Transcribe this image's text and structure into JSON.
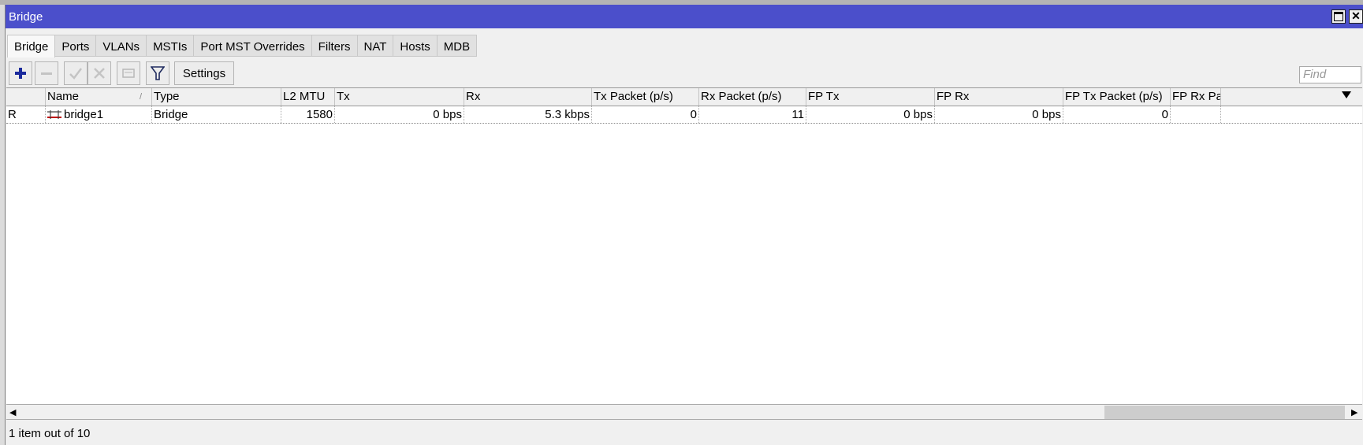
{
  "window": {
    "title": "Bridge"
  },
  "tabs": [
    {
      "label": "Bridge"
    },
    {
      "label": "Ports"
    },
    {
      "label": "VLANs"
    },
    {
      "label": "MSTIs"
    },
    {
      "label": "Port MST Overrides"
    },
    {
      "label": "Filters"
    },
    {
      "label": "NAT"
    },
    {
      "label": "Hosts"
    },
    {
      "label": "MDB"
    }
  ],
  "active_tab": "Bridge",
  "toolbar": {
    "add_icon": "plus-icon",
    "remove_icon": "minus-icon",
    "enable_icon": "check-icon",
    "disable_icon": "x-icon",
    "comment_icon": "comment-icon",
    "filter_icon": "filter-icon",
    "settings_label": "Settings",
    "find_placeholder": "Find"
  },
  "table": {
    "columns": [
      "",
      "Name",
      "Type",
      "L2 MTU",
      "Tx",
      "Rx",
      "Tx Packet (p/s)",
      "Rx Packet (p/s)",
      "FP Tx",
      "FP Rx",
      "FP Tx Packet (p/s)",
      "FP Rx Pa"
    ],
    "sort_indicator": "/",
    "rows": [
      {
        "flag": "R",
        "name": "bridge1",
        "type": "Bridge",
        "l2_mtu": "1580",
        "tx": "0 bps",
        "rx": "5.3 kbps",
        "tx_packet": "0",
        "rx_packet": "11",
        "fp_tx": "0 bps",
        "fp_rx": "0 bps",
        "fp_tx_packet": "0",
        "fp_rx_packet": ""
      }
    ]
  },
  "status": {
    "text": "1 item out of 10"
  },
  "colors": {
    "titlebar": "#4b4fcb",
    "add_icon": "#1a2a9c",
    "row_icon": "#c00000"
  }
}
